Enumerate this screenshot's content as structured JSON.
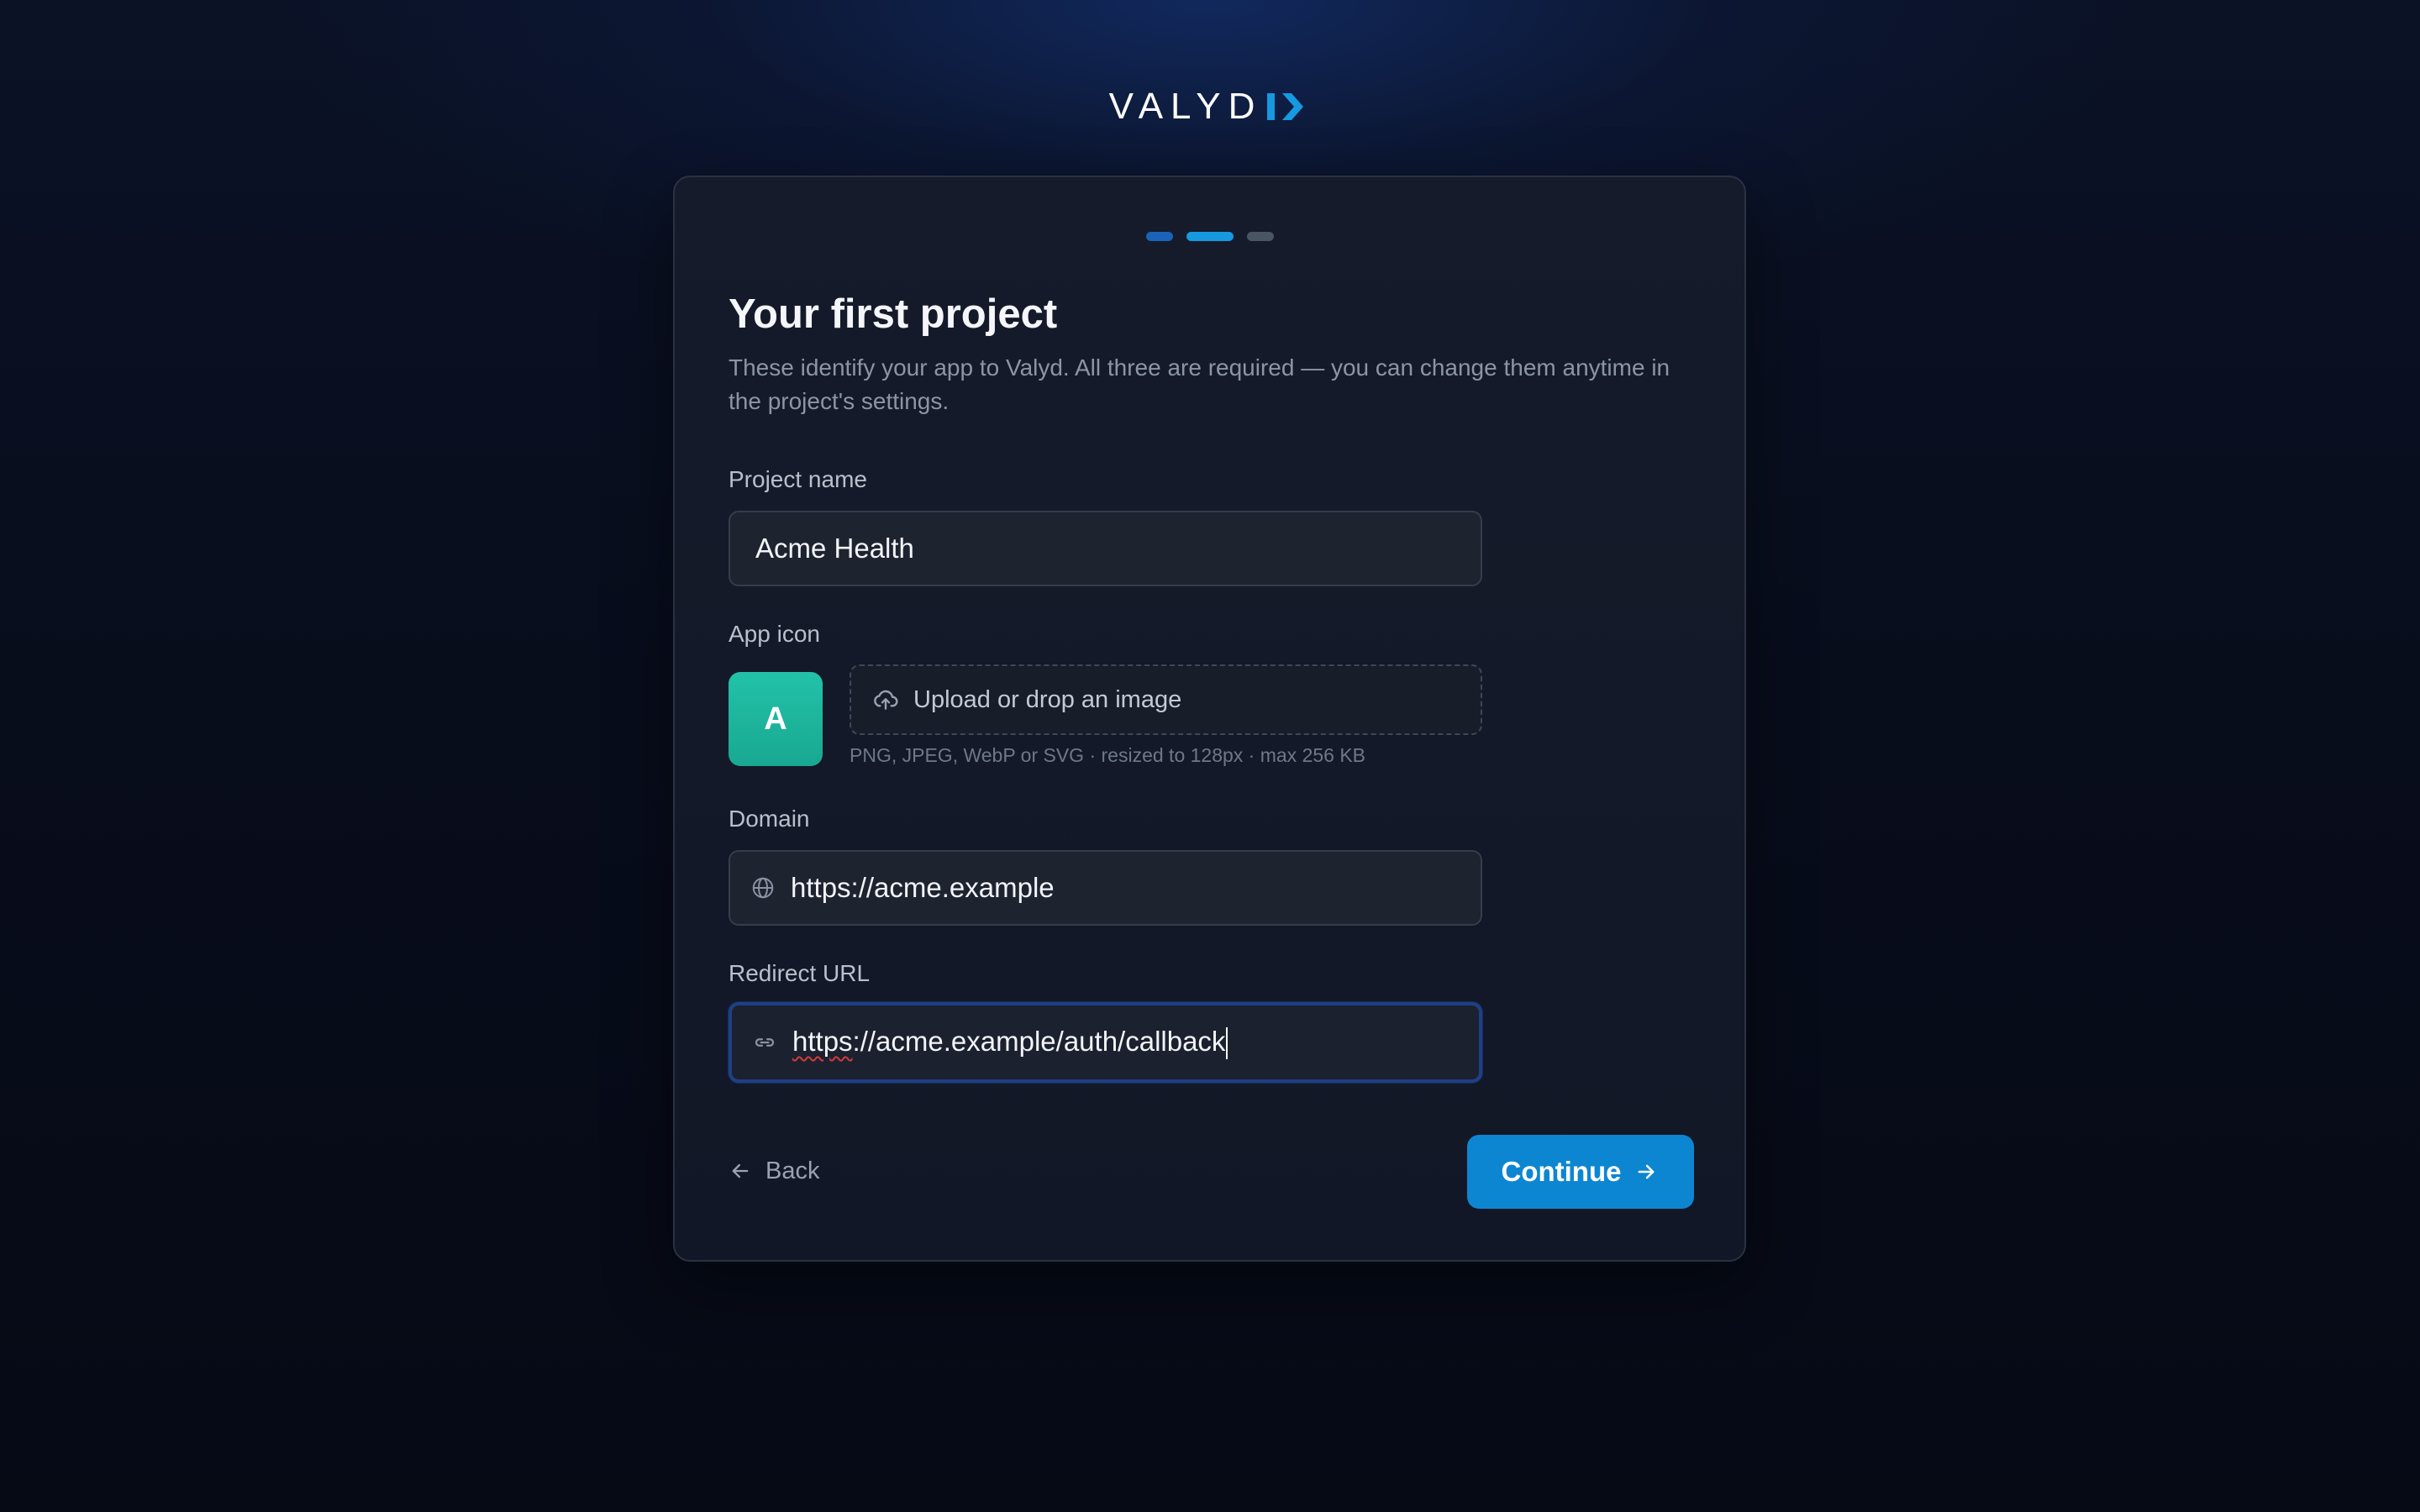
{
  "brand": {
    "name_main": "VALYD",
    "name_mark": "I",
    "accent_color": "#1699e0"
  },
  "stepper": {
    "total_steps": 3,
    "current_step": 2
  },
  "page": {
    "title": "Your first project",
    "subtitle": "These identify your app to Valyd. All three are required — you can change them anytime in the project's settings."
  },
  "form": {
    "project_name": {
      "label": "Project name",
      "value": "Acme Health"
    },
    "app_icon": {
      "label": "App icon",
      "avatar_letter": "A",
      "avatar_color": "#1fb89f",
      "upload_label": "Upload or drop an image",
      "upload_icon": "cloud-upload-icon",
      "hint": "PNG, JPEG, WebP or SVG · resized to 128px · max 256 KB"
    },
    "domain": {
      "label": "Domain",
      "value": "https://acme.example",
      "icon": "globe-icon"
    },
    "redirect_url": {
      "label": "Redirect URL",
      "value_prefix": "https",
      "value_rest": "://acme.example/auth/callback",
      "icon": "link-icon",
      "focused": true
    }
  },
  "actions": {
    "back_label": "Back",
    "back_icon": "arrow-left-icon",
    "continue_label": "Continue",
    "continue_icon": "arrow-right-icon",
    "continue_color": "#0d86d2"
  }
}
